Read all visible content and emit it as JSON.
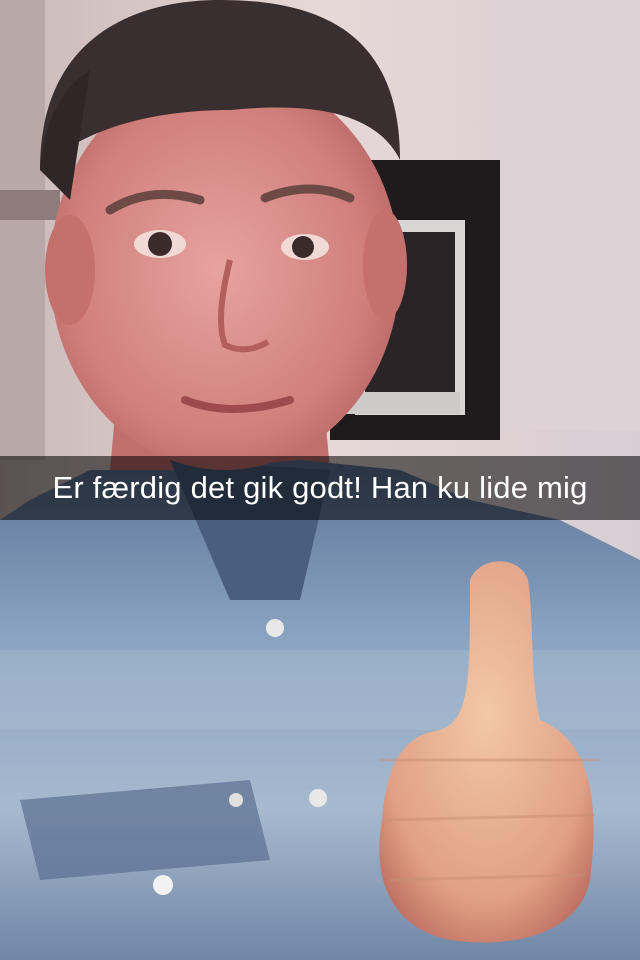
{
  "snap": {
    "caption": "Er færdig det gik godt! Han ku lide mig"
  },
  "scene": {
    "subject": "person-selfie-thumbs-up",
    "colors": {
      "wall": "#e6d8d6",
      "cabinet_dark": "#1f1a1c",
      "skin": "#d88a86",
      "hair": "#3a2f30",
      "denim": "#8aa3c0",
      "denim_dark": "#4a5f80",
      "caption_bg": "#000000",
      "caption_text": "#ffffff"
    }
  }
}
